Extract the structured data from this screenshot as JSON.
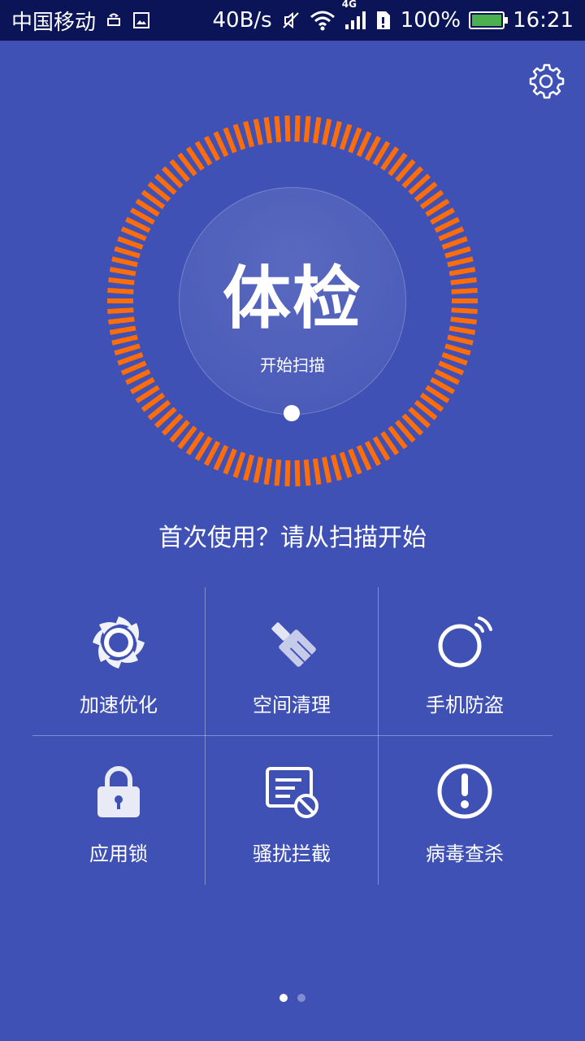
{
  "status_bar": {
    "carrier": "中国移动",
    "speed": "40B/s",
    "network": "4G",
    "battery_percent": "100%",
    "battery_level": 1.0,
    "time": "16:21",
    "icons": [
      "android-icon",
      "image-icon",
      "mute-icon",
      "wifi-icon",
      "signal-icon",
      "sim-icon",
      "battery-icon"
    ]
  },
  "header": {
    "settings_icon": "gear-icon"
  },
  "scan": {
    "title": "体检",
    "subtitle": "开始扫描",
    "ring_color": "#ff6d0a"
  },
  "hint": "首次使用？请从扫描开始",
  "features": [
    {
      "label": "加速优化",
      "icon": "swirl-icon"
    },
    {
      "label": "空间清理",
      "icon": "broom-icon"
    },
    {
      "label": "手机防盗",
      "icon": "signal-ring-icon"
    },
    {
      "label": "应用锁",
      "icon": "padlock-icon"
    },
    {
      "label": "骚扰拦截",
      "icon": "blocked-message-icon"
    },
    {
      "label": "病毒查杀",
      "icon": "exclamation-icon"
    }
  ],
  "pager": {
    "pages": 2,
    "current": 1
  },
  "colors": {
    "background": "#3f51b5",
    "status_bar": "#0a1456",
    "accent": "#ff6d0a"
  }
}
